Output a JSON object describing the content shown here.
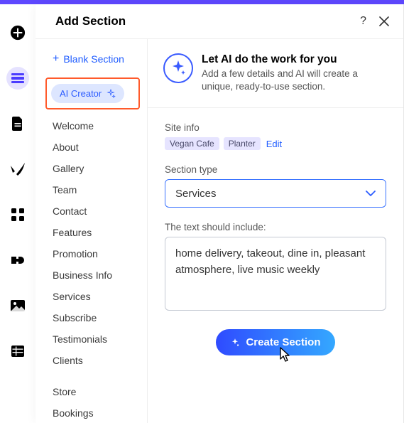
{
  "header": {
    "title": "Add Section"
  },
  "sidebar": {
    "blank_label": "Blank Section",
    "ai_creator_label": "AI Creator",
    "items": [
      "Welcome",
      "About",
      "Gallery",
      "Team",
      "Contact",
      "Features",
      "Promotion",
      "Business Info",
      "Services",
      "Subscribe",
      "Testimonials",
      "Clients"
    ],
    "secondary": [
      "Store",
      "Bookings"
    ]
  },
  "intro": {
    "title": "Let AI do the work for you",
    "desc": "Add a few details and AI will create a unique, ready-to-use section."
  },
  "form": {
    "site_info_label": "Site info",
    "chips": [
      "Vegan Cafe",
      "Planter"
    ],
    "edit_label": "Edit",
    "section_type_label": "Section type",
    "section_type_value": "Services",
    "text_label": "The text should include:",
    "text_value": "home delivery, takeout, dine in, pleasant atmosphere, live music weekly",
    "create_label": "Create Section"
  }
}
